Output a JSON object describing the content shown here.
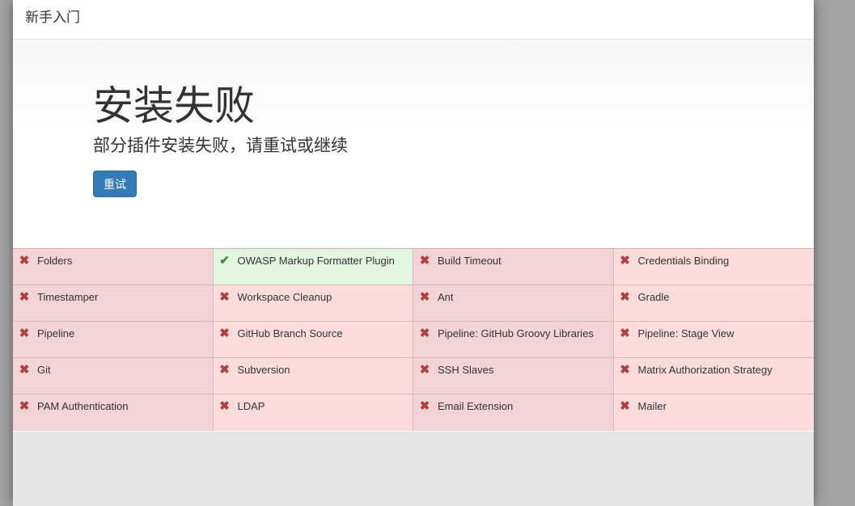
{
  "header": {
    "title": "新手入门"
  },
  "hero": {
    "title": "安装失败",
    "subtitle": "部分插件安装失败，请重试或继续",
    "retry_label": "重试"
  },
  "colors": {
    "failed_bg": "#f2d4d4",
    "success_bg": "#e3f7e0",
    "primary": "#337ab7",
    "fail_icon": "#b04040",
    "ok_icon": "#3c8c3c"
  },
  "plugins": [
    {
      "name": "Folders",
      "status": "failed",
      "icon": "cross-icon"
    },
    {
      "name": "OWASP Markup Formatter Plugin",
      "status": "success",
      "icon": "check-icon"
    },
    {
      "name": "Build Timeout",
      "status": "failed",
      "icon": "cross-icon"
    },
    {
      "name": "Credentials Binding",
      "status": "failed",
      "icon": "cross-icon"
    },
    {
      "name": "Timestamper",
      "status": "failed",
      "icon": "cross-icon"
    },
    {
      "name": "Workspace Cleanup",
      "status": "failed",
      "icon": "cross-icon"
    },
    {
      "name": "Ant",
      "status": "failed",
      "icon": "cross-icon"
    },
    {
      "name": "Gradle",
      "status": "failed",
      "icon": "cross-icon"
    },
    {
      "name": "Pipeline",
      "status": "failed",
      "icon": "cross-icon"
    },
    {
      "name": "GitHub Branch Source",
      "status": "failed",
      "icon": "cross-icon"
    },
    {
      "name": "Pipeline: GitHub Groovy Libraries",
      "status": "failed",
      "icon": "cross-icon"
    },
    {
      "name": "Pipeline: Stage View",
      "status": "failed",
      "icon": "cross-icon"
    },
    {
      "name": "Git",
      "status": "failed",
      "icon": "cross-icon"
    },
    {
      "name": "Subversion",
      "status": "failed",
      "icon": "cross-icon"
    },
    {
      "name": "SSH Slaves",
      "status": "failed",
      "icon": "cross-icon"
    },
    {
      "name": "Matrix Authorization Strategy",
      "status": "failed",
      "icon": "cross-icon"
    },
    {
      "name": "PAM Authentication",
      "status": "failed",
      "icon": "cross-icon"
    },
    {
      "name": "LDAP",
      "status": "failed",
      "icon": "cross-icon"
    },
    {
      "name": "Email Extension",
      "status": "failed",
      "icon": "cross-icon"
    },
    {
      "name": "Mailer",
      "status": "failed",
      "icon": "cross-icon"
    }
  ]
}
